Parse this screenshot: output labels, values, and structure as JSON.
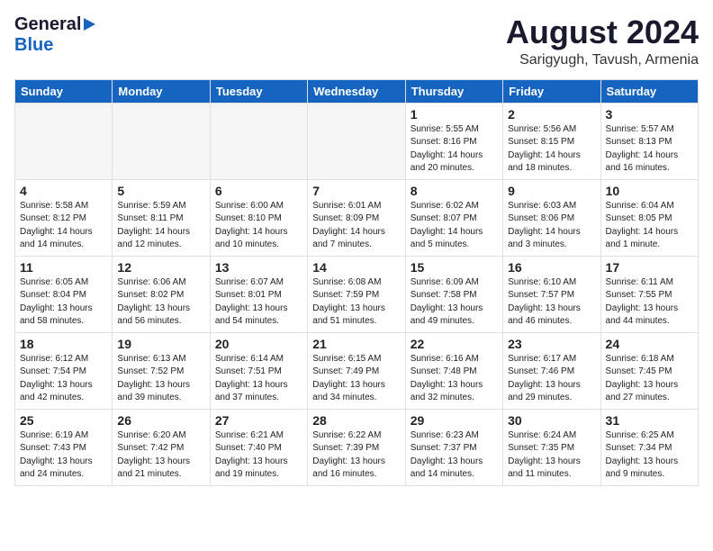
{
  "header": {
    "logo_general": "General",
    "logo_blue": "Blue",
    "month": "August 2024",
    "location": "Sarigyugh, Tavush, Armenia"
  },
  "days_of_week": [
    "Sunday",
    "Monday",
    "Tuesday",
    "Wednesday",
    "Thursday",
    "Friday",
    "Saturday"
  ],
  "weeks": [
    [
      {
        "day": "",
        "info": ""
      },
      {
        "day": "",
        "info": ""
      },
      {
        "day": "",
        "info": ""
      },
      {
        "day": "",
        "info": ""
      },
      {
        "day": "1",
        "info": "Sunrise: 5:55 AM\nSunset: 8:16 PM\nDaylight: 14 hours\nand 20 minutes."
      },
      {
        "day": "2",
        "info": "Sunrise: 5:56 AM\nSunset: 8:15 PM\nDaylight: 14 hours\nand 18 minutes."
      },
      {
        "day": "3",
        "info": "Sunrise: 5:57 AM\nSunset: 8:13 PM\nDaylight: 14 hours\nand 16 minutes."
      }
    ],
    [
      {
        "day": "4",
        "info": "Sunrise: 5:58 AM\nSunset: 8:12 PM\nDaylight: 14 hours\nand 14 minutes."
      },
      {
        "day": "5",
        "info": "Sunrise: 5:59 AM\nSunset: 8:11 PM\nDaylight: 14 hours\nand 12 minutes."
      },
      {
        "day": "6",
        "info": "Sunrise: 6:00 AM\nSunset: 8:10 PM\nDaylight: 14 hours\nand 10 minutes."
      },
      {
        "day": "7",
        "info": "Sunrise: 6:01 AM\nSunset: 8:09 PM\nDaylight: 14 hours\nand 7 minutes."
      },
      {
        "day": "8",
        "info": "Sunrise: 6:02 AM\nSunset: 8:07 PM\nDaylight: 14 hours\nand 5 minutes."
      },
      {
        "day": "9",
        "info": "Sunrise: 6:03 AM\nSunset: 8:06 PM\nDaylight: 14 hours\nand 3 minutes."
      },
      {
        "day": "10",
        "info": "Sunrise: 6:04 AM\nSunset: 8:05 PM\nDaylight: 14 hours\nand 1 minute."
      }
    ],
    [
      {
        "day": "11",
        "info": "Sunrise: 6:05 AM\nSunset: 8:04 PM\nDaylight: 13 hours\nand 58 minutes."
      },
      {
        "day": "12",
        "info": "Sunrise: 6:06 AM\nSunset: 8:02 PM\nDaylight: 13 hours\nand 56 minutes."
      },
      {
        "day": "13",
        "info": "Sunrise: 6:07 AM\nSunset: 8:01 PM\nDaylight: 13 hours\nand 54 minutes."
      },
      {
        "day": "14",
        "info": "Sunrise: 6:08 AM\nSunset: 7:59 PM\nDaylight: 13 hours\nand 51 minutes."
      },
      {
        "day": "15",
        "info": "Sunrise: 6:09 AM\nSunset: 7:58 PM\nDaylight: 13 hours\nand 49 minutes."
      },
      {
        "day": "16",
        "info": "Sunrise: 6:10 AM\nSunset: 7:57 PM\nDaylight: 13 hours\nand 46 minutes."
      },
      {
        "day": "17",
        "info": "Sunrise: 6:11 AM\nSunset: 7:55 PM\nDaylight: 13 hours\nand 44 minutes."
      }
    ],
    [
      {
        "day": "18",
        "info": "Sunrise: 6:12 AM\nSunset: 7:54 PM\nDaylight: 13 hours\nand 42 minutes."
      },
      {
        "day": "19",
        "info": "Sunrise: 6:13 AM\nSunset: 7:52 PM\nDaylight: 13 hours\nand 39 minutes."
      },
      {
        "day": "20",
        "info": "Sunrise: 6:14 AM\nSunset: 7:51 PM\nDaylight: 13 hours\nand 37 minutes."
      },
      {
        "day": "21",
        "info": "Sunrise: 6:15 AM\nSunset: 7:49 PM\nDaylight: 13 hours\nand 34 minutes."
      },
      {
        "day": "22",
        "info": "Sunrise: 6:16 AM\nSunset: 7:48 PM\nDaylight: 13 hours\nand 32 minutes."
      },
      {
        "day": "23",
        "info": "Sunrise: 6:17 AM\nSunset: 7:46 PM\nDaylight: 13 hours\nand 29 minutes."
      },
      {
        "day": "24",
        "info": "Sunrise: 6:18 AM\nSunset: 7:45 PM\nDaylight: 13 hours\nand 27 minutes."
      }
    ],
    [
      {
        "day": "25",
        "info": "Sunrise: 6:19 AM\nSunset: 7:43 PM\nDaylight: 13 hours\nand 24 minutes."
      },
      {
        "day": "26",
        "info": "Sunrise: 6:20 AM\nSunset: 7:42 PM\nDaylight: 13 hours\nand 21 minutes."
      },
      {
        "day": "27",
        "info": "Sunrise: 6:21 AM\nSunset: 7:40 PM\nDaylight: 13 hours\nand 19 minutes."
      },
      {
        "day": "28",
        "info": "Sunrise: 6:22 AM\nSunset: 7:39 PM\nDaylight: 13 hours\nand 16 minutes."
      },
      {
        "day": "29",
        "info": "Sunrise: 6:23 AM\nSunset: 7:37 PM\nDaylight: 13 hours\nand 14 minutes."
      },
      {
        "day": "30",
        "info": "Sunrise: 6:24 AM\nSunset: 7:35 PM\nDaylight: 13 hours\nand 11 minutes."
      },
      {
        "day": "31",
        "info": "Sunrise: 6:25 AM\nSunset: 7:34 PM\nDaylight: 13 hours\nand 9 minutes."
      }
    ]
  ]
}
